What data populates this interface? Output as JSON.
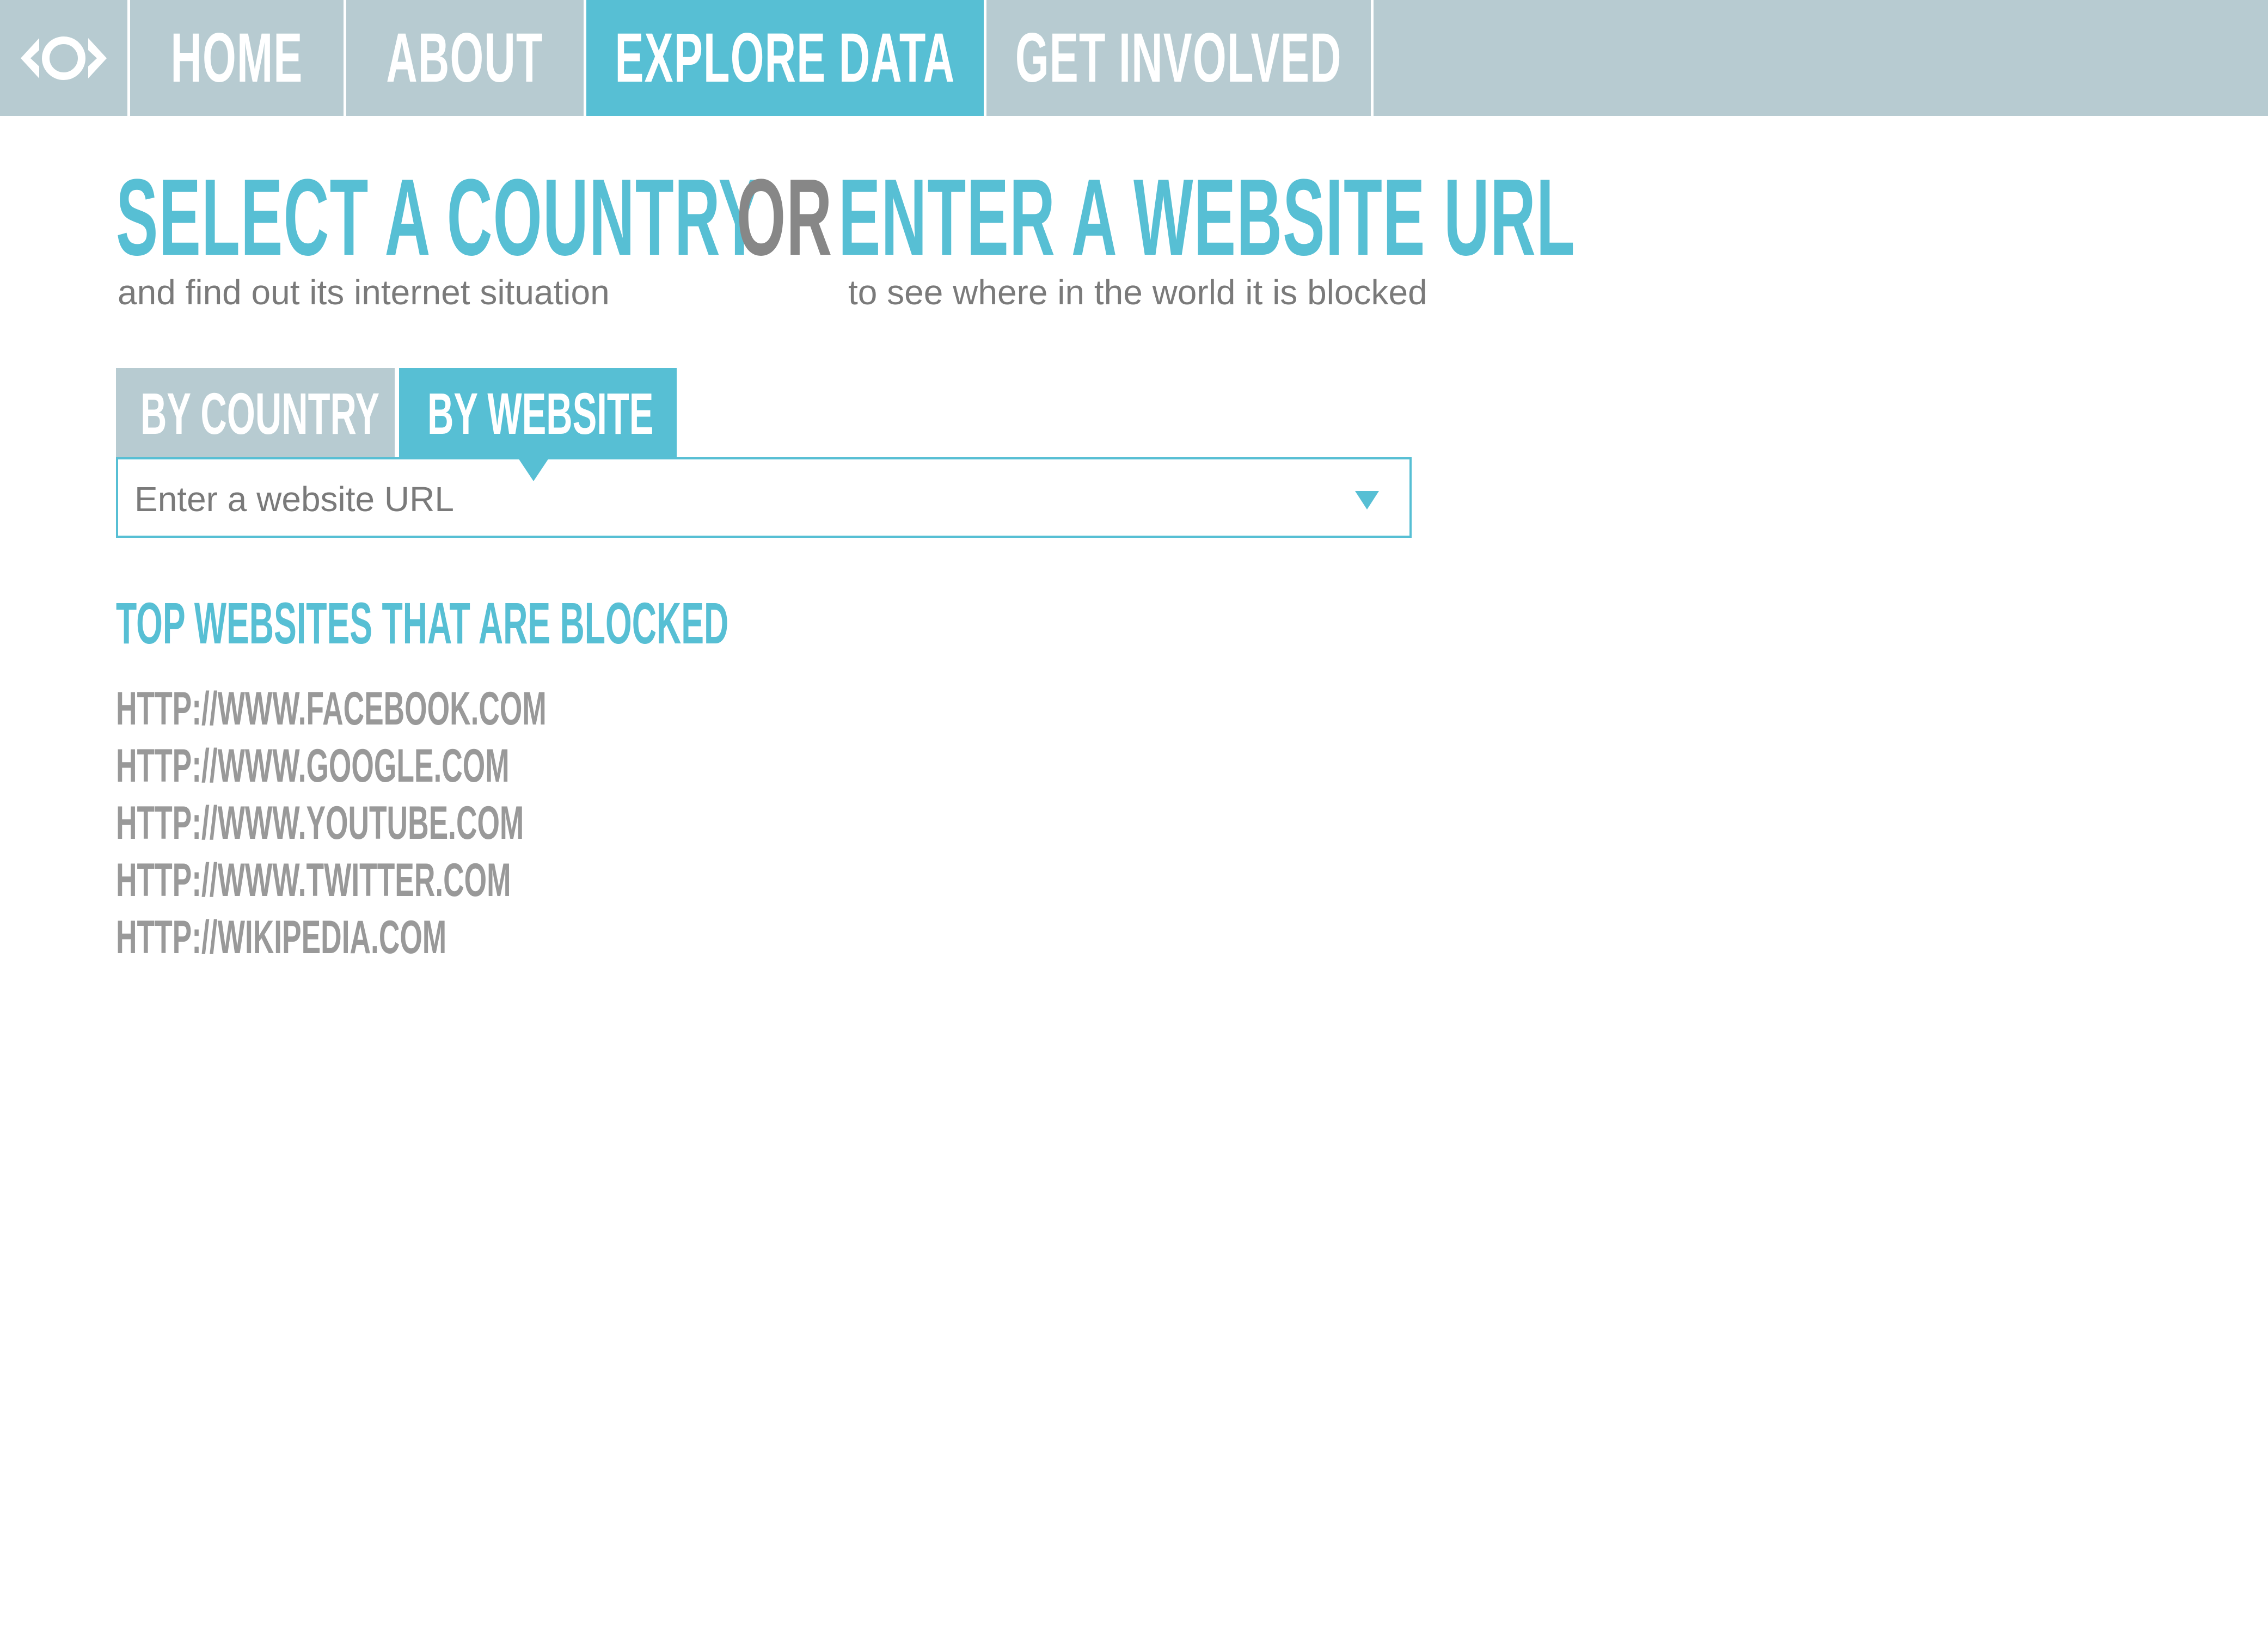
{
  "nav": {
    "logo_icon": "eye-icon",
    "items": [
      {
        "label": "HOME"
      },
      {
        "label": "ABOUT"
      },
      {
        "label": "EXPLORE DATA",
        "active": true
      },
      {
        "label": "GET INVOLVED"
      }
    ]
  },
  "headline": {
    "part1": "SELECT A COUNTRY",
    "part2": "OR",
    "part3": "ENTER A WEBSITE URL",
    "sub_left": "and find out its internet situation",
    "sub_right": "to see where in the world it is blocked"
  },
  "tabs": {
    "by_country": "BY COUNTRY",
    "by_website": "BY WEBSITE",
    "active": "by_website"
  },
  "search": {
    "placeholder": "Enter a website URL",
    "value": ""
  },
  "blocked": {
    "title": "TOP WEBSITES THAT ARE BLOCKED",
    "sites": [
      "HTTP://WWW.FACEBOOK.COM",
      "HTTP://WWW.GOOGLE.COM",
      "HTTP://WWW.YOUTUBE.COM",
      "HTTP://WWW.TWITTER.COM",
      "HTTP://WIKIPEDIA.COM"
    ]
  },
  "colors": {
    "accent": "#57bfd4",
    "nav_bg": "#b7cbd1",
    "text_gray": "#7a7a7a",
    "link_gray": "#999999"
  }
}
